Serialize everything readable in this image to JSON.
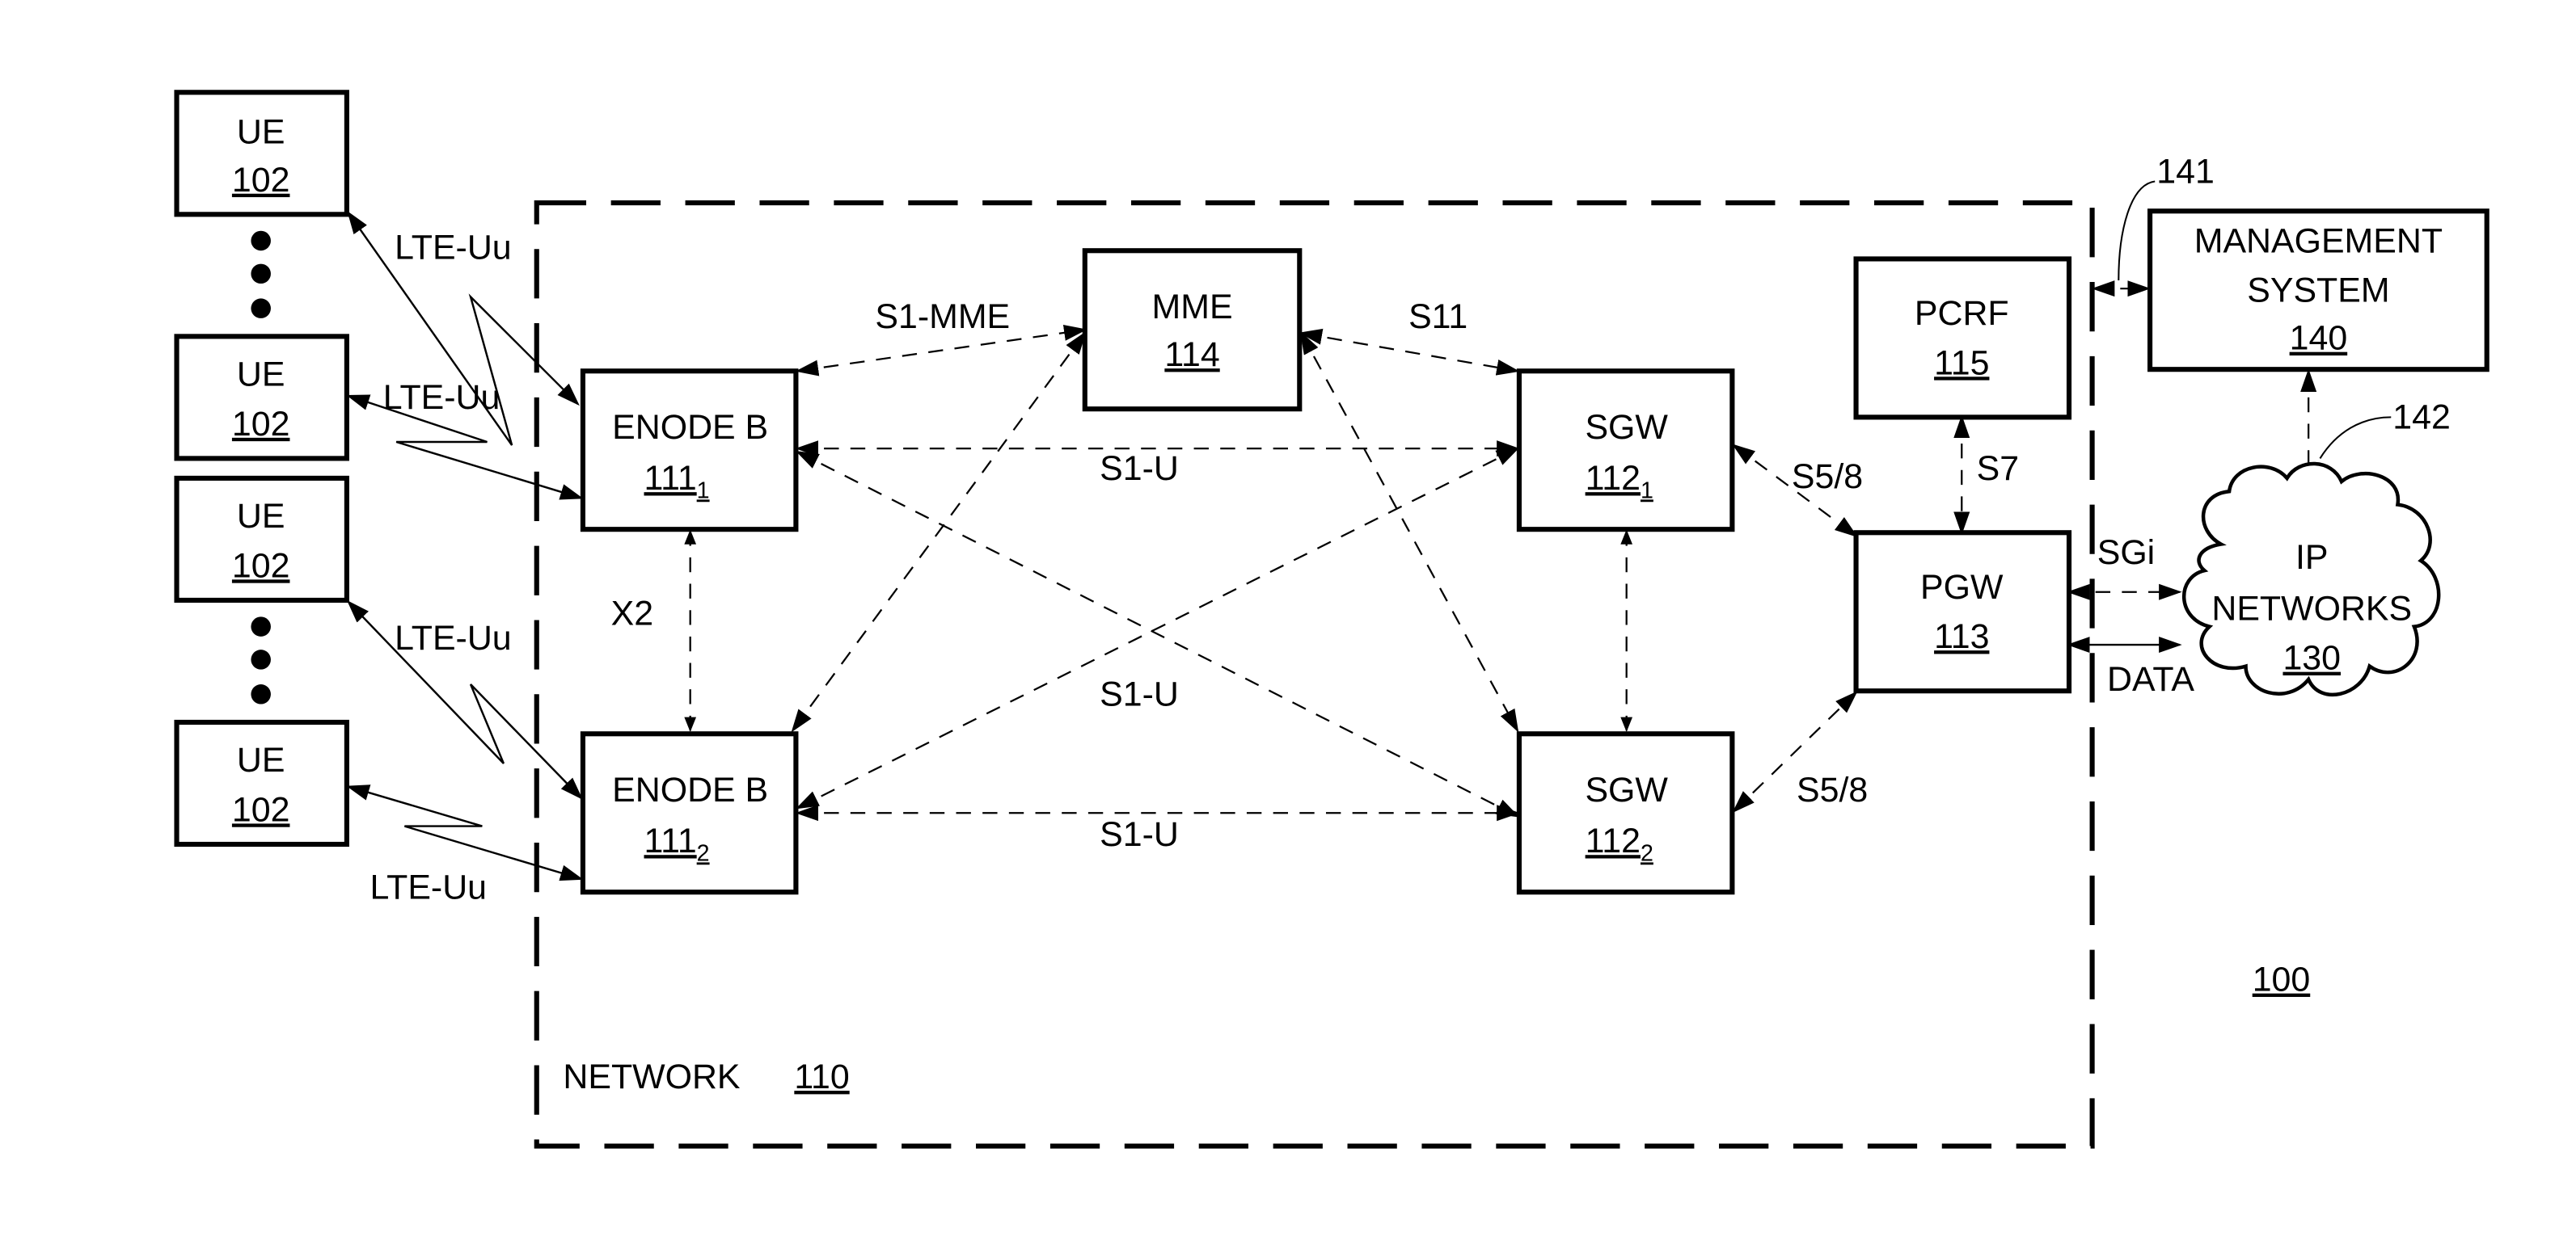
{
  "figure_ref": "100",
  "network": {
    "label": "NETWORK",
    "ref": "110"
  },
  "ues": [
    {
      "label": "UE",
      "ref": "102"
    },
    {
      "label": "UE",
      "ref": "102"
    },
    {
      "label": "UE",
      "ref": "102"
    },
    {
      "label": "UE",
      "ref": "102"
    }
  ],
  "enodeb1": {
    "label": "ENODE B",
    "ref": "111",
    "sub": "1"
  },
  "enodeb2": {
    "label": "ENODE B",
    "ref": "111",
    "sub": "2"
  },
  "mme": {
    "label": "MME",
    "ref": "114"
  },
  "sgw1": {
    "label": "SGW",
    "ref": "112",
    "sub": "1"
  },
  "sgw2": {
    "label": "SGW",
    "ref": "112",
    "sub": "2"
  },
  "pcrf": {
    "label": "PCRF",
    "ref": "115"
  },
  "pgw": {
    "label": "PGW",
    "ref": "113"
  },
  "mgmt": {
    "line1": "MANAGEMENT",
    "line2": "SYSTEM",
    "ref": "140"
  },
  "ipnet": {
    "line1": "IP",
    "line2": "NETWORKS",
    "ref": "130"
  },
  "interfaces": {
    "lte_uu": "LTE-Uu",
    "s1_mme": "S1-MME",
    "s11": "S11",
    "s1_u": "S1-U",
    "x2": "X2",
    "s5_8": "S5/8",
    "s7": "S7",
    "sgi": "SGi",
    "data": "DATA"
  },
  "callouts": {
    "c141": "141",
    "c142": "142"
  }
}
